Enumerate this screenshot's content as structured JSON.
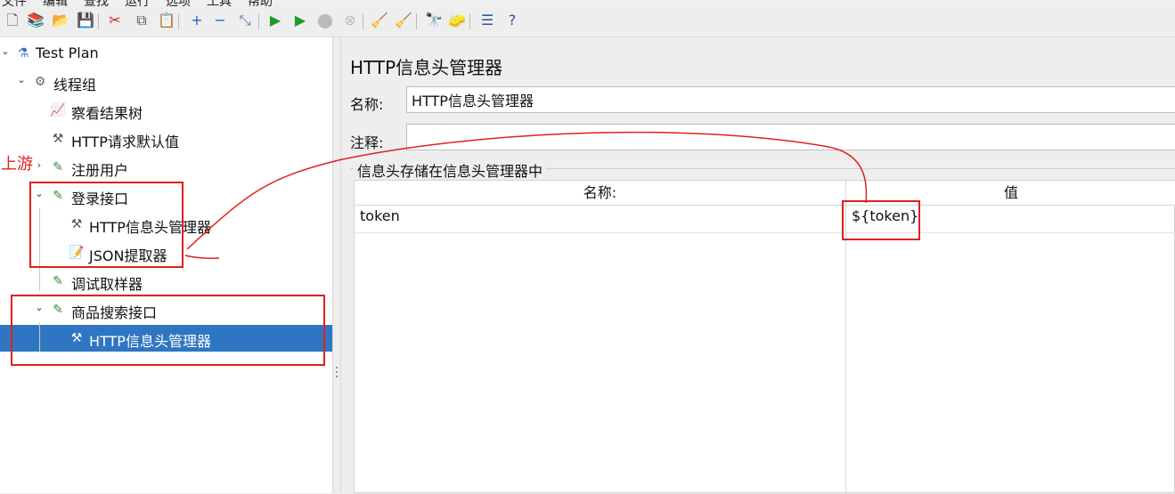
{
  "menu": [
    "文件",
    "编辑",
    "查找",
    "运行",
    "选项",
    "工具",
    "帮助"
  ],
  "toolbar": {
    "buttons": [
      {
        "icon": "new-icon",
        "glyph": "🗋",
        "color": "#555555"
      },
      {
        "icon": "templates-icon",
        "glyph": "📚",
        "color": "#2a7d2a"
      },
      {
        "icon": "open-icon",
        "glyph": "📂",
        "color": "#d19a00"
      },
      {
        "icon": "save-icon",
        "glyph": "💾",
        "color": "#333333"
      },
      {
        "icon": "cut-icon",
        "glyph": "✂",
        "color": "#cc2222"
      },
      {
        "icon": "copy-icon",
        "glyph": "⧉",
        "color": "#555555"
      },
      {
        "icon": "paste-icon",
        "glyph": "📋",
        "color": "#8a6a00"
      },
      {
        "icon": "expand-icon",
        "glyph": "+",
        "color": "#2266cc"
      },
      {
        "icon": "collapse-icon",
        "glyph": "−",
        "color": "#2266cc"
      },
      {
        "icon": "toggle-icon",
        "glyph": "⤡",
        "color": "#4477aa"
      },
      {
        "icon": "start-icon",
        "glyph": "▶",
        "color": "#1f9a2a"
      },
      {
        "icon": "start-no-pause-icon",
        "glyph": "▶",
        "color": "#1f9a2a"
      },
      {
        "icon": "stop-icon",
        "glyph": "⬤",
        "color": "#bbbbbb"
      },
      {
        "icon": "shutdown-icon",
        "glyph": "⊗",
        "color": "#bbbbbb"
      },
      {
        "icon": "clear-icon",
        "glyph": "🧹",
        "color": "#a07a2a"
      },
      {
        "icon": "clear-all-icon",
        "glyph": "🧹",
        "color": "#a07a2a"
      },
      {
        "icon": "search-icon",
        "glyph": "🔭",
        "color": "#333333"
      },
      {
        "icon": "reset-search-icon",
        "glyph": "🧽",
        "color": "#d1a000"
      },
      {
        "icon": "function-helper-icon",
        "glyph": "☰",
        "color": "#3355aa"
      },
      {
        "icon": "help-icon",
        "glyph": "?",
        "color": "#2a5599"
      }
    ]
  },
  "tree": {
    "items": [
      {
        "label": "Test Plan",
        "icon": "flask-icon",
        "glyph": "⚗",
        "color": "#3a6cc0",
        "level": 0,
        "expanded": true
      },
      {
        "label": "线程组",
        "icon": "gear-icon",
        "glyph": "⚙",
        "color": "#666666",
        "level": 1,
        "expanded": true
      },
      {
        "label": "察看结果树",
        "icon": "graph-icon",
        "glyph": "📈",
        "color": "#c04080",
        "level": 2
      },
      {
        "label": "HTTP请求默认值",
        "icon": "wrench-icon",
        "glyph": "⚒",
        "color": "#555555",
        "level": 2
      },
      {
        "label": "注册用户",
        "icon": "pipette-icon",
        "glyph": "✎",
        "color": "#3a8a3a",
        "level": 2,
        "expanded": false
      },
      {
        "label": "登录接口",
        "icon": "pipette-icon",
        "glyph": "✎",
        "color": "#3a8a3a",
        "level": 2,
        "expanded": true
      },
      {
        "label": "HTTP信息头管理器",
        "icon": "wrench-icon",
        "glyph": "⚒",
        "color": "#555555",
        "level": 3
      },
      {
        "label": "JSON提取器",
        "icon": "extractor-icon",
        "glyph": "📝",
        "color": "#2a66aa",
        "level": 3
      },
      {
        "label": "调试取样器",
        "icon": "pipette-icon",
        "glyph": "✎",
        "color": "#3a8a3a",
        "level": 2
      },
      {
        "label": "商品搜索接口",
        "icon": "pipette-icon",
        "glyph": "✎",
        "color": "#3a8a3a",
        "level": 2,
        "expanded": true
      },
      {
        "label": "HTTP信息头管理器",
        "icon": "wrench-icon",
        "glyph": "⚒",
        "color": "#555555",
        "level": 3,
        "selected": true
      }
    ]
  },
  "annotation": {
    "upstream_label": "上游",
    "color": "#e02020"
  },
  "panel": {
    "title": "HTTP信息头管理器",
    "name_label": "名称:",
    "name_value": "HTTP信息头管理器",
    "comment_label": "注释:",
    "comment_value": "",
    "group_title": "信息头存储在信息头管理器中",
    "table": {
      "headers": [
        "名称:",
        "值"
      ],
      "rows": [
        [
          "token",
          "${token}"
        ]
      ]
    }
  },
  "colors": {
    "selection": "#2f76c2",
    "panel_bg": "#eeeeee"
  }
}
